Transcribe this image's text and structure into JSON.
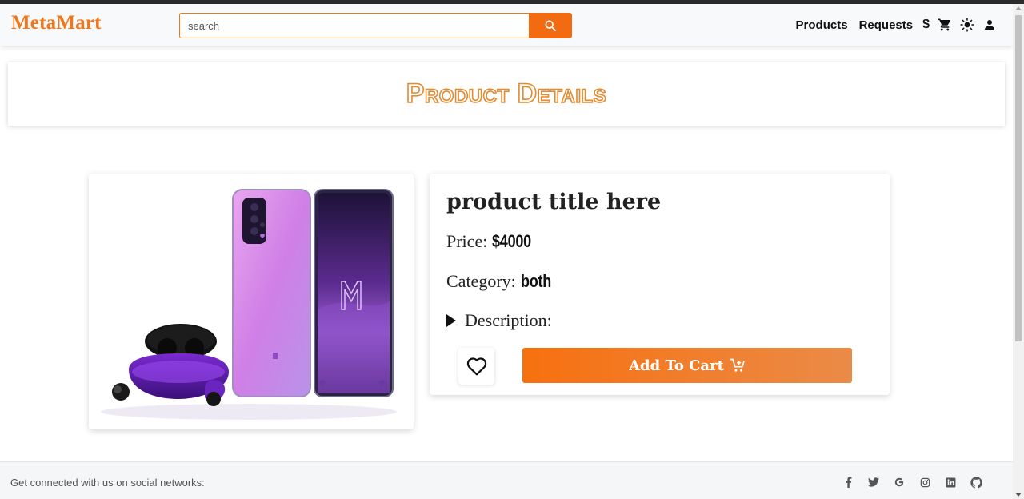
{
  "brand": {
    "name": "MetaMart",
    "color": "#f0761c"
  },
  "search": {
    "placeholder": "search",
    "value": "",
    "button_icon": "search-icon"
  },
  "nav": {
    "links": [
      "Products",
      "Requests"
    ],
    "currency_symbol": "$",
    "icons": [
      "cart-icon",
      "theme-sun-icon",
      "user-icon"
    ]
  },
  "banner": {
    "title": "Product Details",
    "color": "#e58a2e"
  },
  "product": {
    "title": "product title here",
    "price_label": "Price:",
    "price_value": "$4000",
    "category_label": "Category:",
    "category_value": "both",
    "description_label": "Description:",
    "image_alt": "purple smartphones with earbuds"
  },
  "actions": {
    "wishlist_icon": "heart-icon",
    "add_to_cart_label": "Add To Cart",
    "cart_icon": "cart-plus-icon",
    "accent": "#f7700f"
  },
  "footer": {
    "text": "Get connected with us on social networks:",
    "socials": [
      "facebook-icon",
      "twitter-icon",
      "google-icon",
      "instagram-icon",
      "linkedin-icon",
      "github-icon"
    ]
  }
}
